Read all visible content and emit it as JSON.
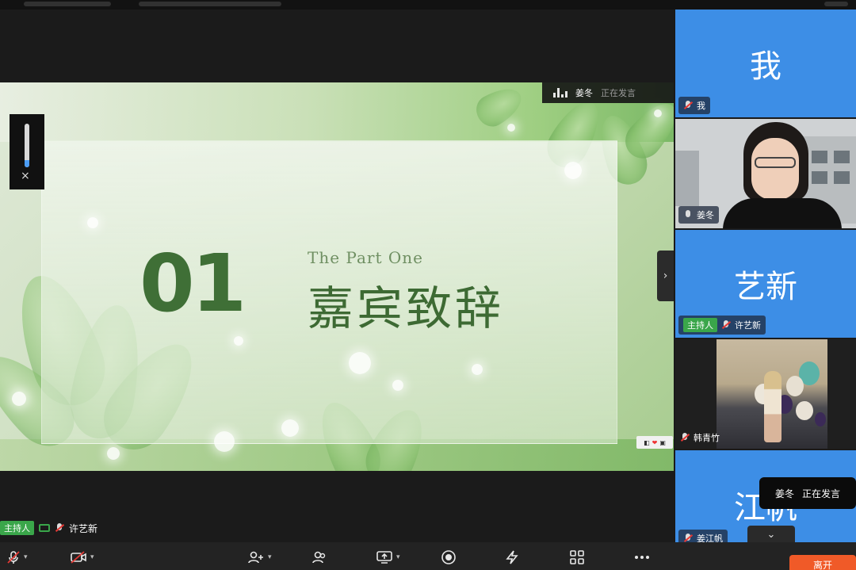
{
  "stage": {
    "slide": {
      "number": "01",
      "subtitle": "The Part One",
      "title": "嘉宾致辞"
    },
    "speaking_indicator": {
      "name": "姜冬",
      "status": "正在发言"
    },
    "volume_close": "×",
    "expand_arrow": "›",
    "bottom_label": {
      "role": "主持人",
      "name": "许艺新"
    }
  },
  "gallery": {
    "tiles": [
      {
        "type": "avatar",
        "display": "我",
        "label": "我",
        "muted": true
      },
      {
        "type": "video",
        "label": "姜冬",
        "muted": false
      },
      {
        "type": "avatar",
        "display": "艺新",
        "role": "主持人",
        "label": "许艺新",
        "muted": true
      },
      {
        "type": "photo",
        "label": "韩青竹",
        "muted": true
      },
      {
        "type": "avatar",
        "display": "江帆",
        "label": "姜江帆",
        "muted": true
      }
    ]
  },
  "toast": {
    "name": "姜冬",
    "status": "正在发言"
  },
  "collapse_glyph": "⌄",
  "toolbar": {
    "leave_label": "离开"
  },
  "colors": {
    "avatar_bg": "#3d8ee6",
    "host_badge": "#3aa64a",
    "leave": "#f05a28",
    "slide_text": "#3d6a33"
  }
}
